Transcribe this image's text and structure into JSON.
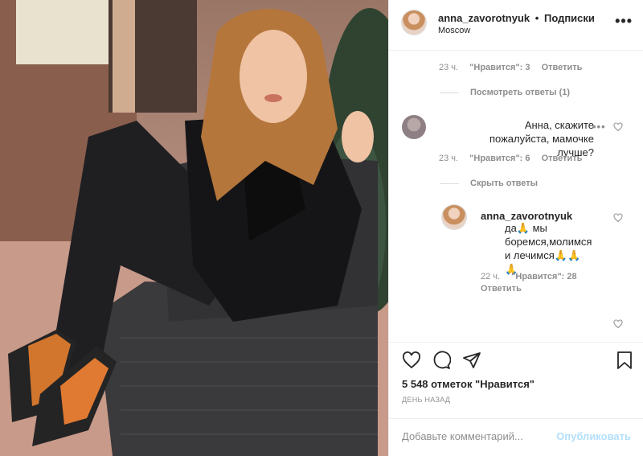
{
  "post": {
    "username": "anna_zavorotnyuk",
    "separator": "•",
    "follow_label": "Подписки",
    "location": "Moscow",
    "more_label": "•••"
  },
  "comments": {
    "first_meta": {
      "time": "23 ч.",
      "likes": "\"Нравится\": 3",
      "reply": "Ответить"
    },
    "view_replies": "Посмотреть ответы (1)",
    "second": {
      "text": "Анна, скажите пожалуйста, мамочке лучше?",
      "time": "23 ч.",
      "likes": "\"Нравится\": 6",
      "reply": "Ответить"
    },
    "hide_replies": "Скрыть ответы",
    "reply": {
      "username": "anna_zavorotnyuk",
      "text": "да🙏 мы боремся,молимся и лечимся🙏🙏🙏",
      "time": "22 ч.",
      "likes": "\"Нравится\": 28",
      "reply": "Ответить"
    }
  },
  "footer": {
    "likes_count": "5 548 отметок \"Нравится\"",
    "date": "ДЕНЬ НАЗАД",
    "comment_placeholder": "Добавьте комментарий...",
    "publish_label": "Опубликовать"
  },
  "icons": {
    "like": "heart-icon",
    "comment": "comment-bubble-icon",
    "share": "paper-plane-icon",
    "save": "bookmark-icon"
  },
  "colors": {
    "text": "#262626",
    "secondary": "#8e8e8e",
    "publish_disabled": "#b2dffc",
    "border": "#efefef"
  }
}
